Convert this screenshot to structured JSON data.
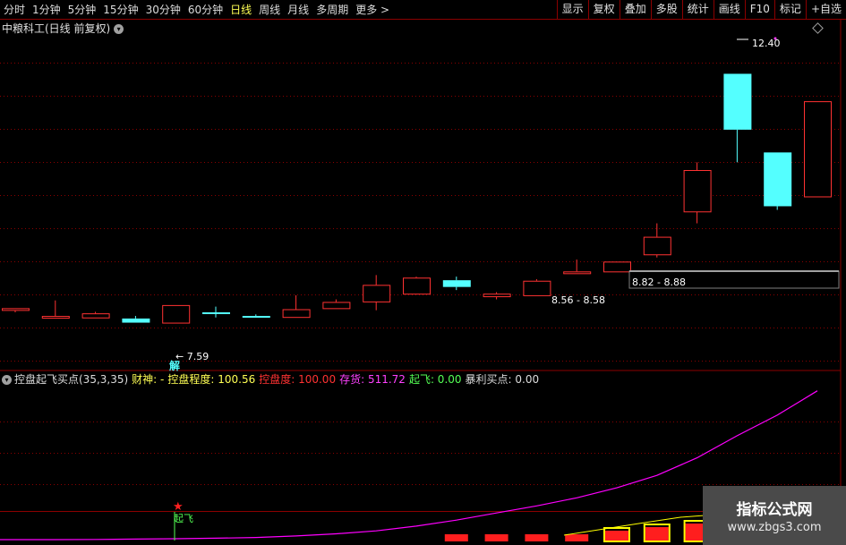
{
  "toolbar": {
    "periods": [
      {
        "label": "分时",
        "active": false
      },
      {
        "label": "1分钟",
        "active": false
      },
      {
        "label": "5分钟",
        "active": false
      },
      {
        "label": "15分钟",
        "active": false
      },
      {
        "label": "30分钟",
        "active": false
      },
      {
        "label": "60分钟",
        "active": false
      },
      {
        "label": "日线",
        "active": true
      },
      {
        "label": "周线",
        "active": false
      },
      {
        "label": "月线",
        "active": false
      },
      {
        "label": "多周期",
        "active": false
      },
      {
        "label": "更多 >",
        "active": false
      }
    ],
    "buttons": [
      "显示",
      "复权",
      "叠加",
      "多股",
      "统计",
      "画线",
      "F10",
      "标记",
      "+自选"
    ]
  },
  "header": {
    "title": "中粮科工(日线 前复权)"
  },
  "colors": {
    "up": "#ff3232",
    "down": "#54ffff",
    "grid": "#8b0000",
    "line": "#ff00ff",
    "flag": "#54ff54"
  },
  "chart_data": {
    "type": "candlestick",
    "price_axis": {
      "min": 6.7,
      "max": 13.1
    },
    "candles": [
      {
        "open": 7.84,
        "close": 7.87,
        "high": 7.87,
        "low": 7.79,
        "dir": "up"
      },
      {
        "open": 7.69,
        "close": 7.72,
        "high": 8.02,
        "low": 7.69,
        "dir": "up"
      },
      {
        "open": 7.69,
        "close": 7.77,
        "high": 7.8,
        "low": 7.69,
        "dir": "up"
      },
      {
        "open": 7.67,
        "close": 7.59,
        "high": 7.72,
        "low": 7.59,
        "dir": "down"
      },
      {
        "open": 7.59,
        "close": 7.93,
        "high": 7.93,
        "low": 7.59,
        "dir": "up"
      },
      {
        "open": 7.79,
        "close": 7.77,
        "high": 7.9,
        "low": 7.69,
        "dir": "down"
      },
      {
        "open": 7.72,
        "close": 7.7,
        "high": 7.75,
        "low": 7.69,
        "dir": "down"
      },
      {
        "open": 7.7,
        "close": 7.85,
        "high": 8.12,
        "low": 7.7,
        "dir": "up"
      },
      {
        "open": 7.87,
        "close": 7.99,
        "high": 8.04,
        "low": 7.87,
        "dir": "up"
      },
      {
        "open": 8.0,
        "close": 8.32,
        "high": 8.51,
        "low": 7.83,
        "dir": "up"
      },
      {
        "open": 8.15,
        "close": 8.46,
        "high": 8.48,
        "low": 8.15,
        "dir": "up"
      },
      {
        "open": 8.41,
        "close": 8.28,
        "high": 8.48,
        "low": 8.22,
        "dir": "down"
      },
      {
        "open": 8.1,
        "close": 8.15,
        "high": 8.18,
        "low": 8.04,
        "dir": "up"
      },
      {
        "open": 8.12,
        "close": 8.4,
        "high": 8.43,
        "low": 8.12,
        "dir": "up"
      },
      {
        "open": 8.55,
        "close": 8.58,
        "high": 8.81,
        "low": 8.55,
        "dir": "up"
      },
      {
        "open": 8.58,
        "close": 8.77,
        "high": 8.77,
        "low": 8.58,
        "dir": "up"
      },
      {
        "open": 8.91,
        "close": 9.25,
        "high": 9.51,
        "low": 8.85,
        "dir": "up"
      },
      {
        "open": 9.74,
        "close": 10.54,
        "high": 10.69,
        "low": 9.51,
        "dir": "up"
      },
      {
        "open": 12.4,
        "close": 11.32,
        "high": 12.4,
        "low": 10.69,
        "dir": "down"
      },
      {
        "open": 10.88,
        "close": 9.84,
        "high": 10.88,
        "low": 9.77,
        "dir": "down"
      },
      {
        "open": 10.03,
        "close": 11.87,
        "high": 11.87,
        "low": 10.03,
        "dir": "up"
      }
    ],
    "annotations": {
      "high_label": "12.40",
      "low_label": "7.59",
      "range1": "8.56 - 8.58",
      "range2": "8.82 - 8.88",
      "jie_label": "解",
      "qifei_label": "起飞"
    },
    "indicator": {
      "name": "控盘起飞买点(35,3,35)",
      "caishen": "财神: -",
      "kongpan_degree": "控盘程度: 100.56",
      "kongpan": "控盘度: 100.00",
      "cunhuo": "存货: 511.72",
      "qifei": "起飞: 0.00",
      "baoli": "暴利买点: 0.00",
      "line_values": [
        0.0,
        0.0,
        0.1,
        0.3,
        0.5,
        0.8,
        1.2,
        2.0,
        3.2,
        4.8,
        7.4,
        10.7,
        14.6,
        18.5,
        22.9,
        28.4,
        35.2,
        44.8,
        56.9,
        68.2,
        81.5
      ],
      "bar_values": [
        0,
        0,
        0,
        0,
        0,
        0,
        0,
        0,
        0,
        0,
        0,
        2,
        2,
        2,
        2,
        3,
        4,
        5,
        6,
        6,
        7
      ]
    }
  },
  "watermark": {
    "line1": "指标公式网",
    "line2": "www.zbgs3.com"
  }
}
